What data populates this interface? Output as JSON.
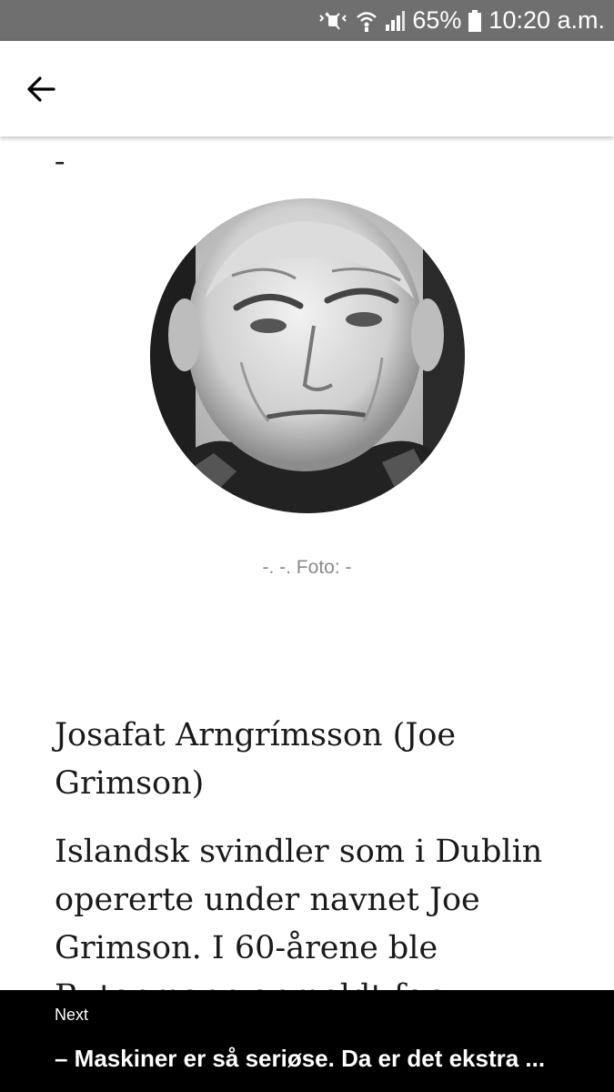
{
  "status_bar": {
    "battery": "65%",
    "time": "10:20 a.m.",
    "icons": [
      "mute-icon",
      "wifi-icon",
      "signal-icon",
      "battery-icon"
    ]
  },
  "app_bar": {
    "back_icon": "arrow-left-icon"
  },
  "article": {
    "kicker": "-",
    "photo_caption": "-. -. Foto: -",
    "headline": "Josafat Arngrímsson (Joe Grimson)",
    "body": "Islandsk svindler som i Dublin opererte under navnet Joe Grimson. I 60-årene ble Rutenmann anmeldt for"
  },
  "next": {
    "label": "Next",
    "title": "– Maskiner er så seriøse. Da er det ekstra ..."
  },
  "colors": {
    "status_bar_bg": "#6f6f6f",
    "next_bar_bg": "#000000",
    "caption_text": "#8a8a8a"
  }
}
